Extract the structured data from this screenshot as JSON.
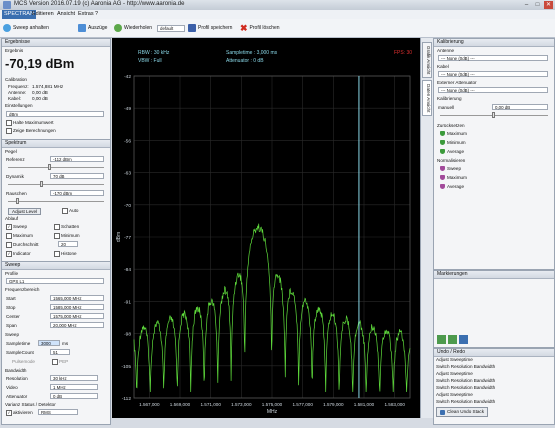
{
  "window": {
    "title": "MCS Version 2016.07.19 (c) Aaronia AG - http://www.aaronia.de"
  },
  "menu": [
    "SPECTRAN",
    "Editieren",
    "Ansicht",
    "Extras",
    "?"
  ],
  "toolbar": {
    "sweep_start": "Sweep anhalten",
    "auszuege": "Auszüge",
    "wiederholen": "Wiederholen",
    "profile_select": "default",
    "profil_speichern": "Profil speichern",
    "profil_loeschen": "Profil löschen"
  },
  "left": {
    "ergebnisse": {
      "header": "Ergebnisse",
      "ergebnis_label": "Ergebnis",
      "value": "-70,19 dBm",
      "calibration_label": "Calibration",
      "freq_label": "Frequenz:",
      "freq_value": "1.574,881 MHz",
      "antenne_label": "Antenne:",
      "antenne_value": "0,00 dB",
      "kabel_label": "Kabel:",
      "kabel_value": "0,00 dB",
      "einstellungen_label": "Einstellungen",
      "unit_select": "dBm",
      "halte_max": "Halte Maximumwert",
      "zeige_abw": "Zeige Berechnungen"
    },
    "spektrum": {
      "header": "Spektrum",
      "pegel_label": "Pegel",
      "referenz_label": "Referenz",
      "referenz_value": "-112 dBm",
      "dynamik_label": "Dynamik",
      "dynamik_value": "70 dB",
      "rauschen_label": "Rauschen",
      "rauschen_value": "-170 dBm",
      "adjust_label": "Adjust Level",
      "auto_label": "Auto",
      "ablauf_label": "Ablauf",
      "sweep": "Sweep",
      "schatten": "Schatten",
      "maximum": "Maximum",
      "minimum": "Minimum",
      "durchschnitt": "Durchschnitt",
      "durchschnitt_value": "20",
      "indicator": "Indicator",
      "histone": "Histone"
    },
    "sweep": {
      "header": "Sweep",
      "profile_label": "Profile",
      "profile_value": "GPS L1",
      "freq_label": "Frequenzbereich",
      "start_label": "Start",
      "start_value": "1565,000 MHz",
      "stop_label": "Stop",
      "stop_value": "1585,000 MHz",
      "center_label": "Center",
      "center_value": "1575,000 MHz",
      "span_label": "Span",
      "span_value": "20,000 MHz",
      "sweep_label": "Sweep",
      "sampletime_label": "Sampletime",
      "sampletime_value": "3000",
      "sampletime_unit": "ms",
      "samplecount_label": "SampleCount",
      "samplecount_value": "51",
      "pulsemode_label": "Pulsemode",
      "pep_label": "PEP",
      "bandwidth_label": "Bandwidth",
      "resolution_label": "Resolution",
      "resolution_value": "30 kHz",
      "video_label": "Video",
      "video_value": "1 MHz",
      "attenuator_label": "Attenuator",
      "attenuator_value": "0 dB",
      "varianz_label": "Varianz Status / Detektor",
      "aktivieren_label": "aktivieren",
      "aktivieren_value": "RMS"
    }
  },
  "plot": {
    "rbw": "RBW : 30 kHz",
    "vbw": "VBW : Full",
    "sampletime": "Sampletime : 3,000 ms",
    "attenuator": "Attenuator : 0 dB",
    "fps": "FPS: 30",
    "y_axis_label": "dBm",
    "x_axis_label": "MHz",
    "y_ticks": [
      "-42",
      "-49",
      "-56",
      "-63",
      "-70",
      "-77",
      "-84",
      "-91",
      "-98",
      "-105",
      "-112"
    ],
    "x_ticks": [
      "1.567,000",
      "1.569,000",
      "1.571,000",
      "1.573,000",
      "1.575,000",
      "1.577,000",
      "1.579,000",
      "1.581,000",
      "1.583,000"
    ],
    "center": "Center: 1.575,000 MHz",
    "rbw_bottom": "2,000 MHz /",
    "span": "Span: 20,000 MHz",
    "trace_color": "#5fdc3c",
    "marker_color": "#8ad8e8"
  },
  "vtabs": [
    "Grafik Ansicht",
    "Daten Ansicht"
  ],
  "right": {
    "kalibrierung_header": "Kalibrierung",
    "antenne_label": "Antenne",
    "antenne_value": "--- None (0dB) ---",
    "kabel_label": "Kabel",
    "kabel_value": "--- None (0dB) ---",
    "ext_att_label": "Externer Attenuator",
    "ext_att_value": "--- None (0dB) ---",
    "kalibrierung_label": "Kalibrierung",
    "manuell_label": "manuell",
    "manuell_value": "0,00 dB",
    "zurueck_label": "Zurücksetzen",
    "reset_items": [
      "Maximum",
      "Minimum",
      "Average"
    ],
    "normalisieren_label": "Normalisieren",
    "norm_items": [
      "Sweep",
      "Maximum",
      "Average"
    ],
    "markierungen_header": "Markierungen",
    "undo_header": "Undo / Redo",
    "undo_items": [
      "Adjust Sweeptime",
      "Switch Resolution Bandwidth",
      "Adjust Sweeptime",
      "Switch Resolution Bandwidth",
      "Switch Resolution Bandwidth",
      "Adjust Sweeptime",
      "Switch Resolution Bandwidth",
      "Adjust Sweeptime"
    ],
    "clean_label": "Clean Undo Stack"
  }
}
